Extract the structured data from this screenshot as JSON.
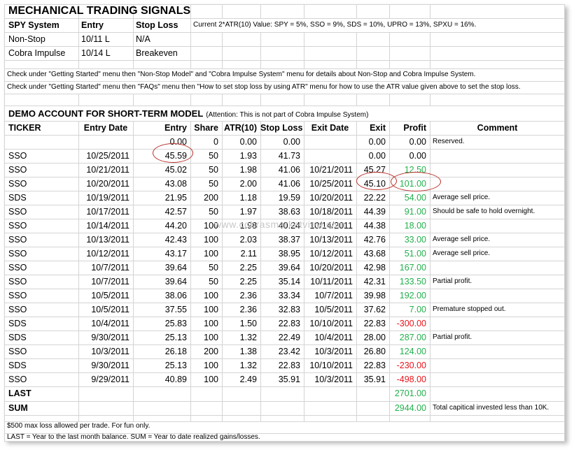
{
  "title": "MECHANICAL TRADING SIGNALS",
  "signals": {
    "headers": [
      "SPY System",
      "Entry",
      "Stop Loss"
    ],
    "atr_note": "Current 2*ATR(10) Value: SPY = 5%, SSO = 9%, SDS = 10%, UPRO = 13%, SPXU = 16%.",
    "rows": [
      {
        "system": "Non-Stop",
        "entry": "10/11 L",
        "stop": "N/A"
      },
      {
        "system": "Cobra Impulse",
        "entry": "10/14 L",
        "stop": "Breakeven"
      }
    ]
  },
  "notes": [
    "Check under \"Getting Started\" menu then \"Non-Stop Model\" and \"Cobra Impulse System\" menu  for details about Non-Stop and Cobra Impulse System.",
    "Check under \"Getting Started\" menu then \"FAQs\" menu then \"How to set stop loss by using ATR\" menu for how to use the ATR value given above to set the stop loss."
  ],
  "demo": {
    "title": "DEMO ACCOUNT FOR SHORT-TERM MODEL",
    "attention": "(Attention: This is not part of Cobra Impulse System)",
    "columns": [
      "TICKER",
      "Entry Date",
      "Entry",
      "Share",
      "ATR(10)",
      "Stop Loss",
      "Exit Date",
      "Exit",
      "Profit",
      "Comment"
    ],
    "rows": [
      {
        "ticker": "",
        "entry_date": "",
        "entry": "0.00",
        "share": "0",
        "atr": "0.00",
        "stop": "0.00",
        "exit_date": "",
        "exit": "0.00",
        "profit": "0.00",
        "comment": "Reserved."
      },
      {
        "ticker": "SSO",
        "entry_date": "10/25/2011",
        "entry": "45.59",
        "share": "50",
        "atr": "1.93",
        "stop": "41.73",
        "exit_date": "",
        "exit": "0.00",
        "profit": "0.00",
        "comment": ""
      },
      {
        "ticker": "SSO",
        "entry_date": "10/21/2011",
        "entry": "45.02",
        "share": "50",
        "atr": "1.98",
        "stop": "41.06",
        "exit_date": "10/21/2011",
        "exit": "45.27",
        "profit": "12.50",
        "comment": ""
      },
      {
        "ticker": "SSO",
        "entry_date": "10/20/2011",
        "entry": "43.08",
        "share": "50",
        "atr": "2.00",
        "stop": "41.06",
        "exit_date": "10/25/2011",
        "exit": "45.10",
        "profit": "101.00",
        "comment": ""
      },
      {
        "ticker": "SDS",
        "entry_date": "10/19/2011",
        "entry": "21.95",
        "share": "200",
        "atr": "1.18",
        "stop": "19.59",
        "exit_date": "10/20/2011",
        "exit": "22.22",
        "profit": "54.00",
        "comment": "Average sell price."
      },
      {
        "ticker": "SSO",
        "entry_date": "10/17/2011",
        "entry": "42.57",
        "share": "50",
        "atr": "1.97",
        "stop": "38.63",
        "exit_date": "10/18/2011",
        "exit": "44.39",
        "profit": "91.00",
        "comment": "Should be safe to hold overnight."
      },
      {
        "ticker": "SSO",
        "entry_date": "10/14/2011",
        "entry": "44.20",
        "share": "100",
        "atr": "1.98",
        "stop": "40.24",
        "exit_date": "10/14/2011",
        "exit": "44.38",
        "profit": "18.00",
        "comment": ""
      },
      {
        "ticker": "SSO",
        "entry_date": "10/13/2011",
        "entry": "42.43",
        "share": "100",
        "atr": "2.03",
        "stop": "38.37",
        "exit_date": "10/13/2011",
        "exit": "42.76",
        "profit": "33.00",
        "comment": "Average sell price."
      },
      {
        "ticker": "SSO",
        "entry_date": "10/12/2011",
        "entry": "43.17",
        "share": "100",
        "atr": "2.11",
        "stop": "38.95",
        "exit_date": "10/12/2011",
        "exit": "43.68",
        "profit": "51.00",
        "comment": "Average sell price."
      },
      {
        "ticker": "SSO",
        "entry_date": "10/7/2011",
        "entry": "39.64",
        "share": "50",
        "atr": "2.25",
        "stop": "39.64",
        "exit_date": "10/20/2011",
        "exit": "42.98",
        "profit": "167.00",
        "comment": ""
      },
      {
        "ticker": "SSO",
        "entry_date": "10/7/2011",
        "entry": "39.64",
        "share": "50",
        "atr": "2.25",
        "stop": "35.14",
        "exit_date": "10/11/2011",
        "exit": "42.31",
        "profit": "133.50",
        "comment": "Partial profit."
      },
      {
        "ticker": "SSO",
        "entry_date": "10/5/2011",
        "entry": "38.06",
        "share": "100",
        "atr": "2.36",
        "stop": "33.34",
        "exit_date": "10/7/2011",
        "exit": "39.98",
        "profit": "192.00",
        "comment": ""
      },
      {
        "ticker": "SSO",
        "entry_date": "10/5/2011",
        "entry": "37.55",
        "share": "100",
        "atr": "2.36",
        "stop": "32.83",
        "exit_date": "10/5/2011",
        "exit": "37.62",
        "profit": "7.00",
        "comment": "Premature stopped out."
      },
      {
        "ticker": "SDS",
        "entry_date": "10/4/2011",
        "entry": "25.83",
        "share": "100",
        "atr": "1.50",
        "stop": "22.83",
        "exit_date": "10/10/2011",
        "exit": "22.83",
        "profit": "-300.00",
        "comment": ""
      },
      {
        "ticker": "SDS",
        "entry_date": "9/30/2011",
        "entry": "25.13",
        "share": "100",
        "atr": "1.32",
        "stop": "22.49",
        "exit_date": "10/4/2011",
        "exit": "28.00",
        "profit": "287.00",
        "comment": "Partial profit."
      },
      {
        "ticker": "SSO",
        "entry_date": "10/3/2011",
        "entry": "26.18",
        "share": "200",
        "atr": "1.38",
        "stop": "23.42",
        "exit_date": "10/3/2011",
        "exit": "26.80",
        "profit": "124.00",
        "comment": ""
      },
      {
        "ticker": "SDS",
        "entry_date": "9/30/2011",
        "entry": "25.13",
        "share": "100",
        "atr": "1.32",
        "stop": "22.83",
        "exit_date": "10/10/2011",
        "exit": "22.83",
        "profit": "-230.00",
        "comment": ""
      },
      {
        "ticker": "SSO",
        "entry_date": "9/29/2011",
        "entry": "40.89",
        "share": "100",
        "atr": "2.49",
        "stop": "35.91",
        "exit_date": "10/3/2011",
        "exit": "35.91",
        "profit": "-498.00",
        "comment": ""
      }
    ],
    "last": {
      "label": "LAST",
      "value": "2701.00"
    },
    "sum": {
      "label": "SUM",
      "value": "2944.00",
      "comment": "Total capitical invested less than 10K."
    }
  },
  "footnotes": [
    "$500 max loss allowed per trade. For fun only.",
    "LAST = Year to the last month balance. SUM = Year to date realized gains/losses."
  ],
  "watermark": "www.cobrasmarketview.com",
  "colors": {
    "gain": "#22b14c",
    "loss": "#e8141b",
    "highlight_oval": "#b8322c",
    "grid": "#d4d4d4"
  }
}
